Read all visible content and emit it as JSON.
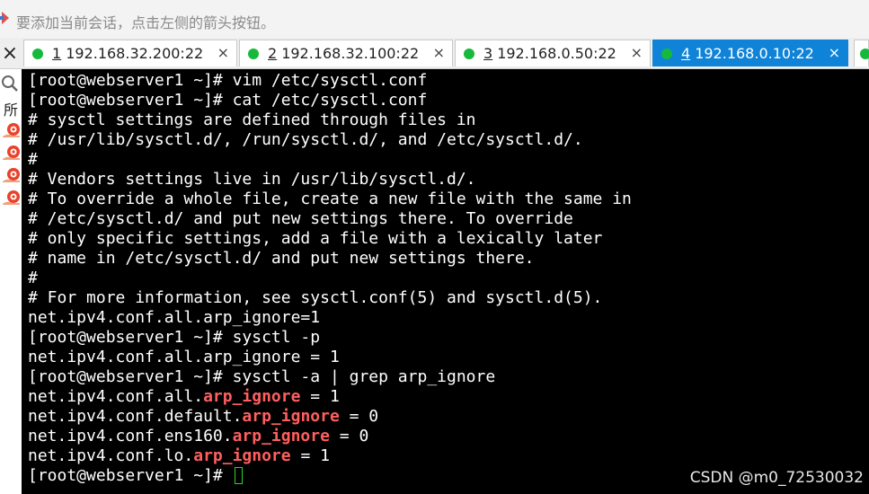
{
  "hint": {
    "text": "要添加当前会话，点击左侧的箭头按钮。",
    "icon": "arrow-hint-icon"
  },
  "tabs": [
    {
      "num": "1",
      "host": "192.168.32.200:22",
      "active": false
    },
    {
      "num": "2",
      "host": "192.168.32.100:22",
      "active": false
    },
    {
      "num": "3",
      "host": "192.168.0.50:22",
      "active": false
    },
    {
      "num": "4",
      "host": "192.168.0.10:22",
      "active": true
    }
  ],
  "tab_close": "×",
  "close_all": "×",
  "sidebar": {
    "label": "所",
    "search_icon": "search-icon",
    "session_icon": "snail-session-icon"
  },
  "terminal": {
    "lines": [
      [
        {
          "t": "[root@webserver1 ~]# vim /etc/sysctl.conf"
        }
      ],
      [
        {
          "t": "[root@webserver1 ~]# cat /etc/sysctl.conf"
        }
      ],
      [
        {
          "t": "# sysctl settings are defined through files in"
        }
      ],
      [
        {
          "t": "# /usr/lib/sysctl.d/, /run/sysctl.d/, and /etc/sysctl.d/."
        }
      ],
      [
        {
          "t": "#"
        }
      ],
      [
        {
          "t": "# Vendors settings live in /usr/lib/sysctl.d/."
        }
      ],
      [
        {
          "t": "# To override a whole file, create a new file with the same in"
        }
      ],
      [
        {
          "t": "# /etc/sysctl.d/ and put new settings there. To override"
        }
      ],
      [
        {
          "t": "# only specific settings, add a file with a lexically later"
        }
      ],
      [
        {
          "t": "# name in /etc/sysctl.d/ and put new settings there."
        }
      ],
      [
        {
          "t": "#"
        }
      ],
      [
        {
          "t": "# For more information, see sysctl.conf(5) and sysctl.d(5)."
        }
      ],
      [
        {
          "t": "net.ipv4.conf.all.arp_ignore=1"
        }
      ],
      [
        {
          "t": "[root@webserver1 ~]# sysctl -p"
        }
      ],
      [
        {
          "t": "net.ipv4.conf.all.arp_ignore = 1"
        }
      ],
      [
        {
          "t": "[root@webserver1 ~]# sysctl -a | grep arp_ignore"
        }
      ],
      [
        {
          "t": "net.ipv4.conf.all."
        },
        {
          "t": "arp_ignore",
          "hl": true
        },
        {
          "t": " = 1"
        }
      ],
      [
        {
          "t": "net.ipv4.conf.default."
        },
        {
          "t": "arp_ignore",
          "hl": true
        },
        {
          "t": " = 0"
        }
      ],
      [
        {
          "t": "net.ipv4.conf.ens160."
        },
        {
          "t": "arp_ignore",
          "hl": true
        },
        {
          "t": " = 0"
        }
      ],
      [
        {
          "t": "net.ipv4.conf.lo."
        },
        {
          "t": "arp_ignore",
          "hl": true
        },
        {
          "t": " = 1"
        }
      ],
      [
        {
          "t": "[root@webserver1 ~]# "
        }
      ]
    ],
    "watermark": "CSDN @m0_72530032",
    "colors": {
      "background": "#000000",
      "text": "#ffffff",
      "highlight": "#ff5f5f",
      "cursor": "#28d828"
    }
  }
}
